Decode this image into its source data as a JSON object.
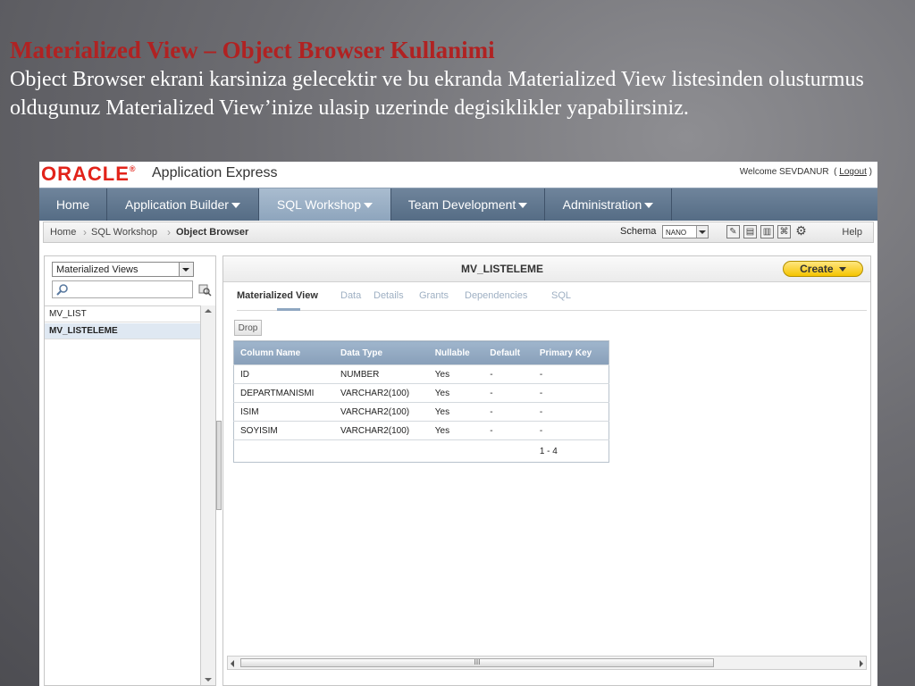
{
  "slide": {
    "title": "Materialized View – Object Browser Kullanimi",
    "body": "Object Browser ekrani karsiniza gelecektir ve bu ekranda Materialized View listesinden olusturmus oldugunuz Materialized View’inize ulasip uzerinde degisiklikler yapabilirsiniz."
  },
  "header": {
    "logo_text": "ORACLE",
    "app_name": "Application Express",
    "welcome": "Welcome SEVDANUR",
    "logout": "Logout"
  },
  "nav": {
    "tabs": [
      {
        "label": "Home"
      },
      {
        "label": "Application Builder"
      },
      {
        "label": "SQL Workshop"
      },
      {
        "label": "Team Development"
      },
      {
        "label": "Administration"
      }
    ]
  },
  "breadcrumb": {
    "items": [
      "Home",
      "SQL Workshop",
      "Object Browser"
    ],
    "schema_label": "Schema",
    "schema_value": "NANO",
    "help": "Help"
  },
  "sidebar": {
    "object_type": "Materialized Views",
    "items": [
      "MV_LIST",
      "MV_LISTELEME"
    ]
  },
  "main": {
    "title": "MV_LISTELEME",
    "create_label": "Create",
    "subtabs": [
      "Materialized View",
      "Data",
      "Details",
      "Grants",
      "Dependencies",
      "SQL"
    ],
    "drop_label": "Drop",
    "columns": [
      "Column Name",
      "Data Type",
      "Nullable",
      "Default",
      "Primary Key"
    ],
    "rows": [
      [
        "ID",
        "NUMBER",
        "Yes",
        "-",
        "-"
      ],
      [
        "DEPARTMANISMI",
        "VARCHAR2(100)",
        "Yes",
        "-",
        "-"
      ],
      [
        "ISIM",
        "VARCHAR2(100)",
        "Yes",
        "-",
        "-"
      ],
      [
        "SOYISIM",
        "VARCHAR2(100)",
        "Yes",
        "-",
        "-"
      ]
    ],
    "pagination": "1 - 4",
    "scroll_grip": "III"
  },
  "colors": {
    "title_red": "#b02222",
    "oracle_red": "#e2231a",
    "nav_blue": "#5f768f",
    "create_yellow": "#f5c400"
  }
}
